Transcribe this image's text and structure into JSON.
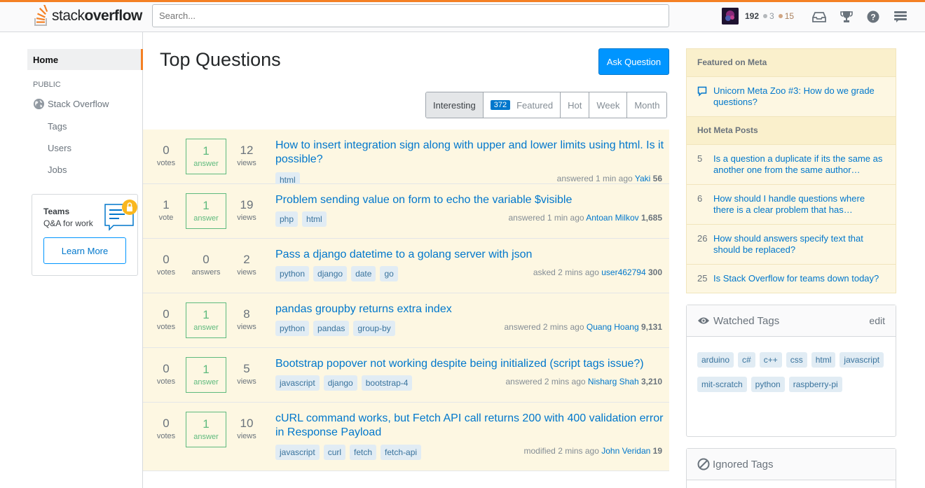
{
  "header": {
    "logo_text_light": "stack",
    "logo_text_bold": "overflow",
    "search_placeholder": "Search...",
    "reputation": "192",
    "silver_badges": "3",
    "bronze_badges": "15"
  },
  "leftnav": {
    "home": "Home",
    "section": "PUBLIC",
    "stack_overflow": "Stack Overflow",
    "tags": "Tags",
    "users": "Users",
    "jobs": "Jobs",
    "teams_title": "Teams",
    "teams_sub": "Q&A for work",
    "learn_more": "Learn More"
  },
  "main": {
    "title": "Top Questions",
    "ask_button": "Ask Question",
    "filters": [
      "Interesting",
      "Featured",
      "Hot",
      "Week",
      "Month"
    ],
    "featured_count": "372",
    "questions": [
      {
        "votes": "0",
        "votes_label": "votes",
        "answers": "1",
        "answers_label": "answer",
        "views": "12",
        "views_label": "views",
        "title": "How to insert integration sign along with upper and lower limits using html. Is it possible?",
        "tags": [
          "html"
        ],
        "action": "answered 1 min ago",
        "user": "Yaki",
        "rep": "56",
        "answered": true
      },
      {
        "votes": "1",
        "votes_label": "vote",
        "answers": "1",
        "answers_label": "answer",
        "views": "19",
        "views_label": "views",
        "title": "Problem sending value on form to echo the variable $visible",
        "tags": [
          "php",
          "html"
        ],
        "action": "answered 1 min ago",
        "user": "Antoan Milkov",
        "rep": "1,685",
        "answered": true
      },
      {
        "votes": "0",
        "votes_label": "votes",
        "answers": "0",
        "answers_label": "answers",
        "views": "2",
        "views_label": "views",
        "title": "Pass a django datetime to a golang server with json",
        "tags": [
          "python",
          "django",
          "date",
          "go"
        ],
        "action": "asked 2 mins ago",
        "user": "user462794",
        "rep": "300",
        "answered": false
      },
      {
        "votes": "0",
        "votes_label": "votes",
        "answers": "1",
        "answers_label": "answer",
        "views": "8",
        "views_label": "views",
        "title": "pandas groupby returns extra index",
        "tags": [
          "python",
          "pandas",
          "group-by"
        ],
        "action": "answered 2 mins ago",
        "user": "Quang Hoang",
        "rep": "9,131",
        "answered": true
      },
      {
        "votes": "0",
        "votes_label": "votes",
        "answers": "1",
        "answers_label": "answer",
        "views": "5",
        "views_label": "views",
        "title": "Bootstrap popover not working despite being initialized (script tags issue?)",
        "tags": [
          "javascript",
          "django",
          "bootstrap-4"
        ],
        "action": "answered 2 mins ago",
        "user": "Nisharg Shah",
        "rep": "3,210",
        "answered": true
      },
      {
        "votes": "0",
        "votes_label": "votes",
        "answers": "1",
        "answers_label": "answer",
        "views": "10",
        "views_label": "views",
        "title": "cURL command works, but Fetch API call returns 200 with 400 validation error in Response Payload",
        "tags": [
          "javascript",
          "curl",
          "fetch",
          "fetch-api"
        ],
        "action": "modified 2 mins ago",
        "user": "John Veridan",
        "rep": "19",
        "answered": true
      }
    ]
  },
  "sidebar": {
    "featured_meta_title": "Featured on Meta",
    "featured_item": "Unicorn Meta Zoo #3: How do we grade questions?",
    "hot_meta_title": "Hot Meta Posts",
    "hot_posts": [
      {
        "num": "5",
        "text": "Is a question a duplicate if its the same as another one from the same author…"
      },
      {
        "num": "6",
        "text": "How should I handle questions where there is a clear problem that has…"
      },
      {
        "num": "26",
        "text": "How should answers specify text that should be replaced?"
      },
      {
        "num": "25",
        "text": "Is Stack Overflow for teams down today?"
      }
    ],
    "watched_title": "Watched Tags",
    "watched_edit": "edit",
    "watched_tags": [
      "arduino",
      "c#",
      "c++",
      "css",
      "html",
      "javascript",
      "mit-scratch",
      "python",
      "raspberry-pi"
    ],
    "ignored_title": "Ignored Tags"
  },
  "colors": {
    "accent_orange": "#f48024",
    "link_blue": "#0077cc",
    "answered_green": "#5eba7d",
    "highlight_bg": "#fdf7e2"
  }
}
